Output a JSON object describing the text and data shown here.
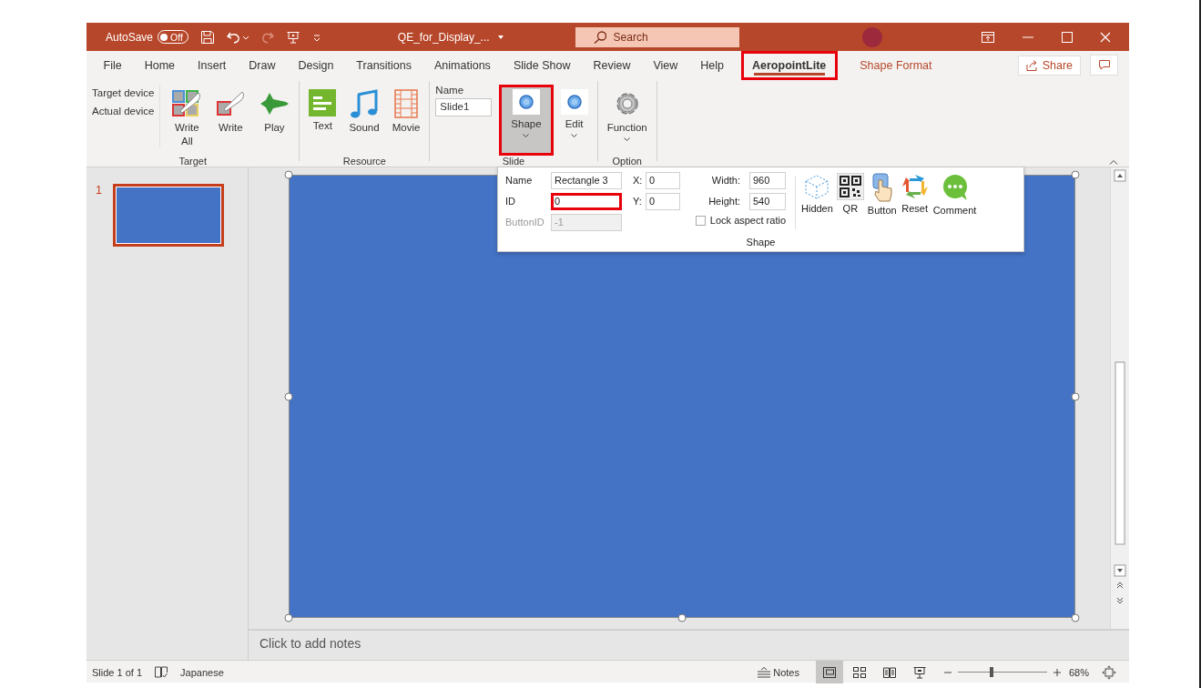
{
  "window": {
    "title": "QE_for_Display_...",
    "autosave": {
      "label": "AutoSave",
      "toggle": "Off",
      "on": false
    },
    "search": {
      "placeholder": "Search"
    }
  },
  "menu_tabs": [
    {
      "label": "File",
      "kind": "standard",
      "selected": false,
      "highlighted": false
    },
    {
      "label": "Home",
      "kind": "standard",
      "selected": false,
      "highlighted": false
    },
    {
      "label": "Insert",
      "kind": "standard",
      "selected": false,
      "highlighted": false
    },
    {
      "label": "Draw",
      "kind": "standard",
      "selected": false,
      "highlighted": false
    },
    {
      "label": "Design",
      "kind": "standard",
      "selected": false,
      "highlighted": false
    },
    {
      "label": "Transitions",
      "kind": "standard",
      "selected": false,
      "highlighted": false
    },
    {
      "label": "Animations",
      "kind": "standard",
      "selected": false,
      "highlighted": false
    },
    {
      "label": "Slide Show",
      "kind": "standard",
      "selected": false,
      "highlighted": false
    },
    {
      "label": "Review",
      "kind": "standard",
      "selected": false,
      "highlighted": false
    },
    {
      "label": "View",
      "kind": "standard",
      "selected": false,
      "highlighted": false
    },
    {
      "label": "Help",
      "kind": "standard",
      "selected": false,
      "highlighted": false
    },
    {
      "label": "AeropointLite",
      "kind": "standard",
      "selected": true,
      "highlighted": true
    },
    {
      "label": "Shape Format",
      "kind": "contextual",
      "selected": false,
      "highlighted": false
    }
  ],
  "share_button": "Share",
  "ribbon": {
    "groups": [
      {
        "label": "Target",
        "items": [
          {
            "kind": "labels",
            "texts": [
              "Target device",
              "Actual device"
            ]
          },
          {
            "kind": "button",
            "label": "Write All",
            "dropdown": false,
            "selected": false,
            "highlighted": false
          },
          {
            "kind": "button",
            "label": "Write",
            "dropdown": false,
            "selected": false,
            "highlighted": false
          },
          {
            "kind": "button",
            "label": "Play",
            "dropdown": false,
            "selected": false,
            "highlighted": false
          }
        ]
      },
      {
        "label": "Resource",
        "items": [
          {
            "kind": "button",
            "label": "Text",
            "dropdown": false,
            "selected": false,
            "highlighted": false
          },
          {
            "kind": "button",
            "label": "Sound",
            "dropdown": false,
            "selected": false,
            "highlighted": false
          },
          {
            "kind": "button",
            "label": "Movie",
            "dropdown": false,
            "selected": false,
            "highlighted": false
          }
        ]
      },
      {
        "label": "Slide",
        "items": [
          {
            "kind": "field",
            "label": "Name",
            "value": "Slide1"
          },
          {
            "kind": "button",
            "label": "Shape",
            "dropdown": true,
            "selected": true,
            "highlighted": true
          },
          {
            "kind": "button",
            "label": "Edit",
            "dropdown": true,
            "selected": false,
            "highlighted": false
          }
        ]
      },
      {
        "label": "Option",
        "items": [
          {
            "kind": "button",
            "label": "Function",
            "dropdown": true,
            "selected": false,
            "highlighted": false
          }
        ]
      }
    ]
  },
  "shape_panel": {
    "fields": [
      {
        "label": "Name",
        "value": "Rectangle 3",
        "disabled": false,
        "highlighted": false
      },
      {
        "label": "ID",
        "value": "0",
        "disabled": false,
        "highlighted": true
      },
      {
        "label": "ButtonID",
        "value": "-1",
        "disabled": true,
        "highlighted": false
      }
    ],
    "position": [
      {
        "label": "X:",
        "value": "0"
      },
      {
        "label": "Y:",
        "value": "0"
      }
    ],
    "size": [
      {
        "label": "Width:",
        "value": "960"
      },
      {
        "label": "Height:",
        "value": "540"
      }
    ],
    "lock_aspect_ratio": {
      "label": "Lock aspect ratio",
      "checked": false
    },
    "buttons": [
      {
        "label": "Hidden"
      },
      {
        "label": "QR"
      },
      {
        "label": "Button"
      },
      {
        "label": "Reset"
      },
      {
        "label": "Comment"
      }
    ],
    "group_label": "Shape"
  },
  "slides": [
    {
      "number": "1",
      "selected": true
    }
  ],
  "notes": {
    "placeholder": "Click to add notes"
  },
  "status_bar": {
    "slide_info": "Slide 1 of 1",
    "language": "Japanese",
    "notes_button": "Notes",
    "views": [
      {
        "kind": "normal",
        "selected": true
      },
      {
        "kind": "sorter",
        "selected": false
      },
      {
        "kind": "reading",
        "selected": false
      },
      {
        "kind": "slideshow",
        "selected": false
      }
    ],
    "zoom": {
      "level": 0.38,
      "reading": "68%"
    }
  }
}
